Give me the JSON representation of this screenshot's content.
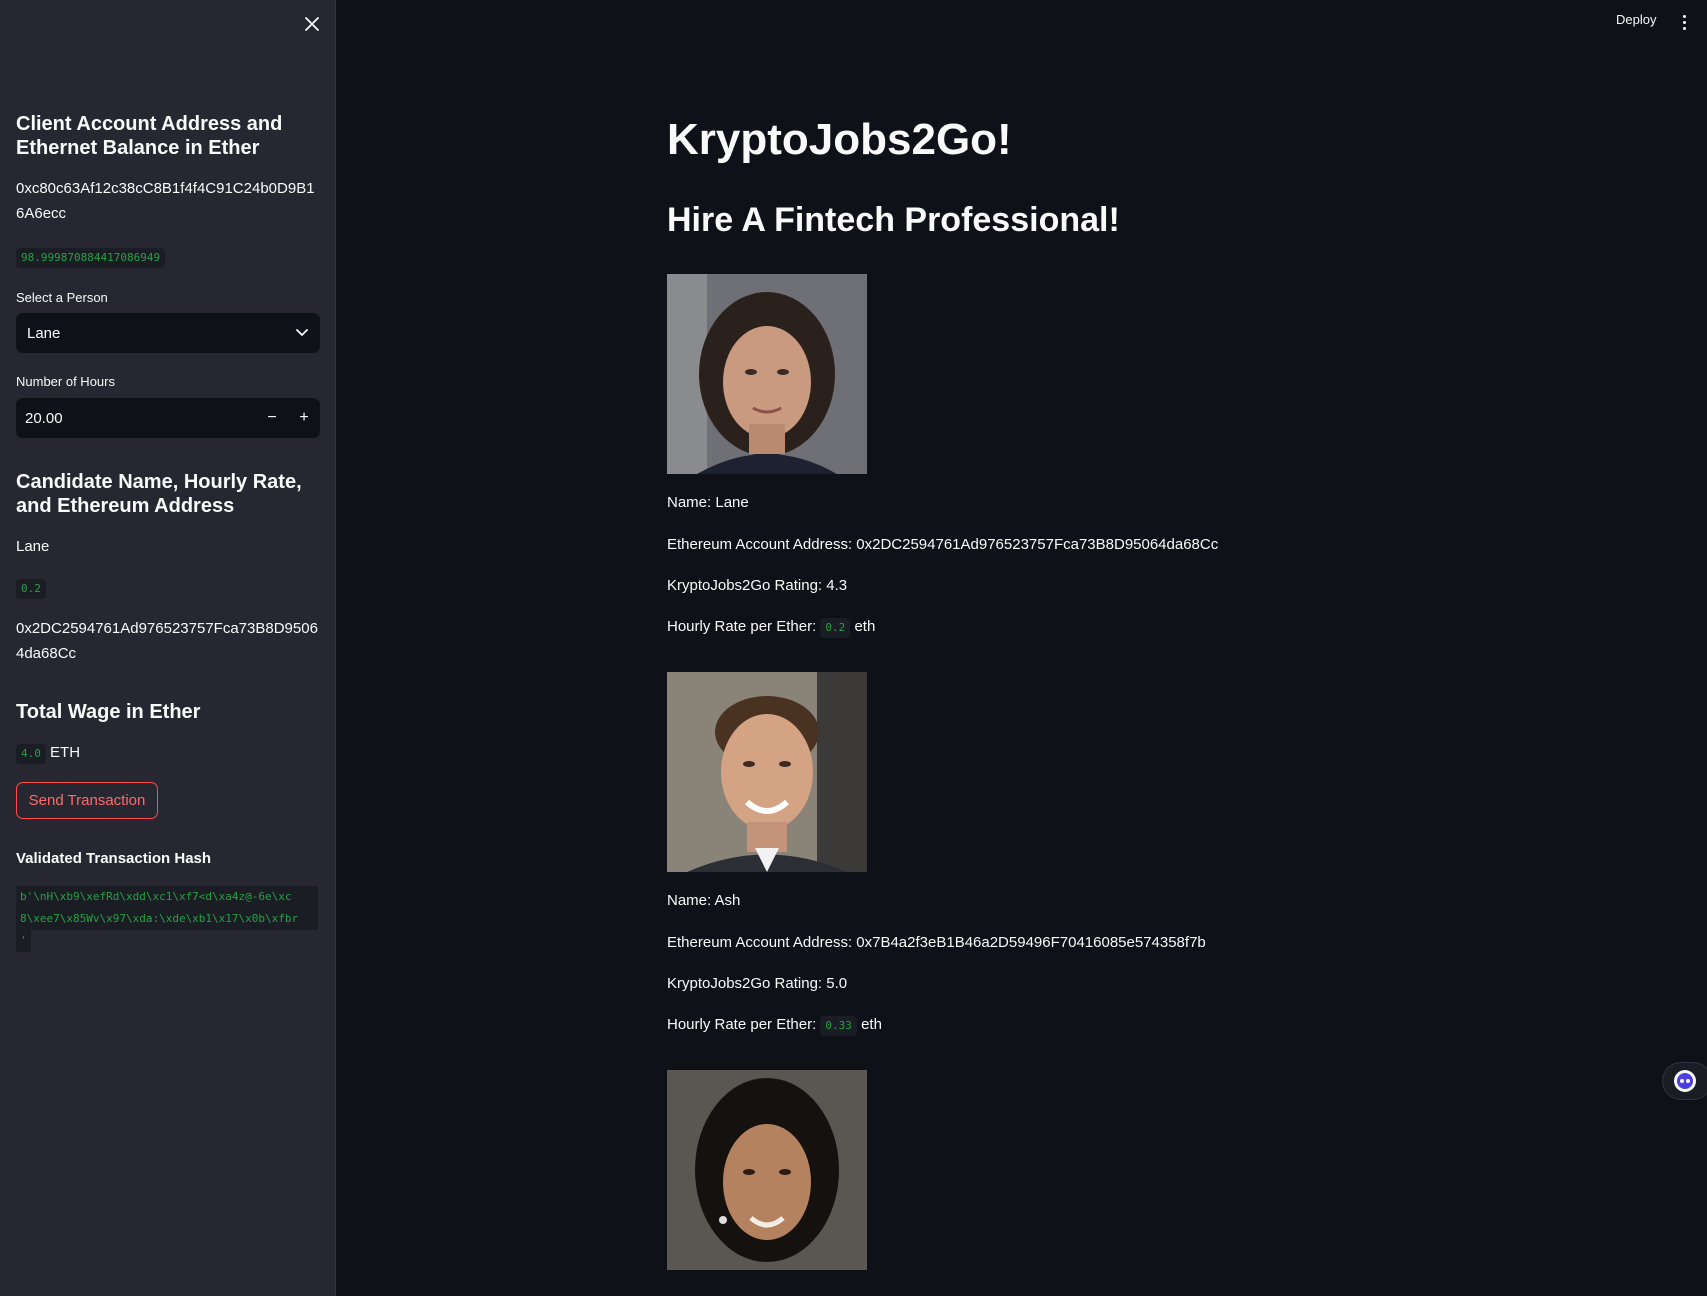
{
  "sidebar": {
    "account_heading": "Client Account Address and Ethernet Balance in Ether",
    "account_address": "0xc80c63Af12c38cC8B1f4f4C91C24b0D9B16A6ecc",
    "balance": "98.999870884417086949",
    "select_label": "Select a Person",
    "select_value": "Lane",
    "hours_label": "Number of Hours",
    "hours_value": "20.00",
    "stepper_minus": "−",
    "stepper_plus": "+",
    "candidate_heading": "Candidate Name, Hourly Rate, and Ethereum Address",
    "candidate_name": "Lane",
    "candidate_rate": "0.2",
    "candidate_address": "0x2DC2594761Ad976523757Fca73B8D95064da68Cc",
    "wage_heading": "Total Wage in Ether",
    "wage_value": "4.0",
    "wage_unit": "ETH",
    "send_button": "Send Transaction",
    "hash_heading": "Validated Transaction Hash",
    "hash_lines": [
      "b'\\nH\\xb9\\xefRd\\xdd\\xc1\\xf7<d\\xa4z@-6e\\xc",
      "8\\xee7\\x85Wv\\x97\\xda:\\xde\\xb1\\x17\\x0b\\xfbr",
      "'"
    ]
  },
  "header": {
    "deploy": "Deploy"
  },
  "main": {
    "title": "KryptoJobs2Go!",
    "subtitle": "Hire A Fintech Professional!",
    "candidates": [
      {
        "name": "Name: Lane",
        "address": "Ethereum Account Address: 0x2DC2594761Ad976523757Fca73B8D95064da68Cc",
        "rating": "KryptoJobs2Go Rating: 4.3",
        "rate_label": "Hourly Rate per Ether:",
        "rate": "0.2",
        "rate_unit": "eth"
      },
      {
        "name": "Name: Ash",
        "address": "Ethereum Account Address: 0x7B4a2f3eB1B46a2D59496F70416085e574358f7b",
        "rating": "KryptoJobs2Go Rating: 5.0",
        "rate_label": "Hourly Rate per Ether:",
        "rate": "0.33",
        "rate_unit": "eth"
      }
    ]
  },
  "icons": {
    "close": "close-icon",
    "chevron": "chevron-down-icon",
    "menu": "kebab-menu-icon",
    "chat": "chat-bot-icon"
  }
}
